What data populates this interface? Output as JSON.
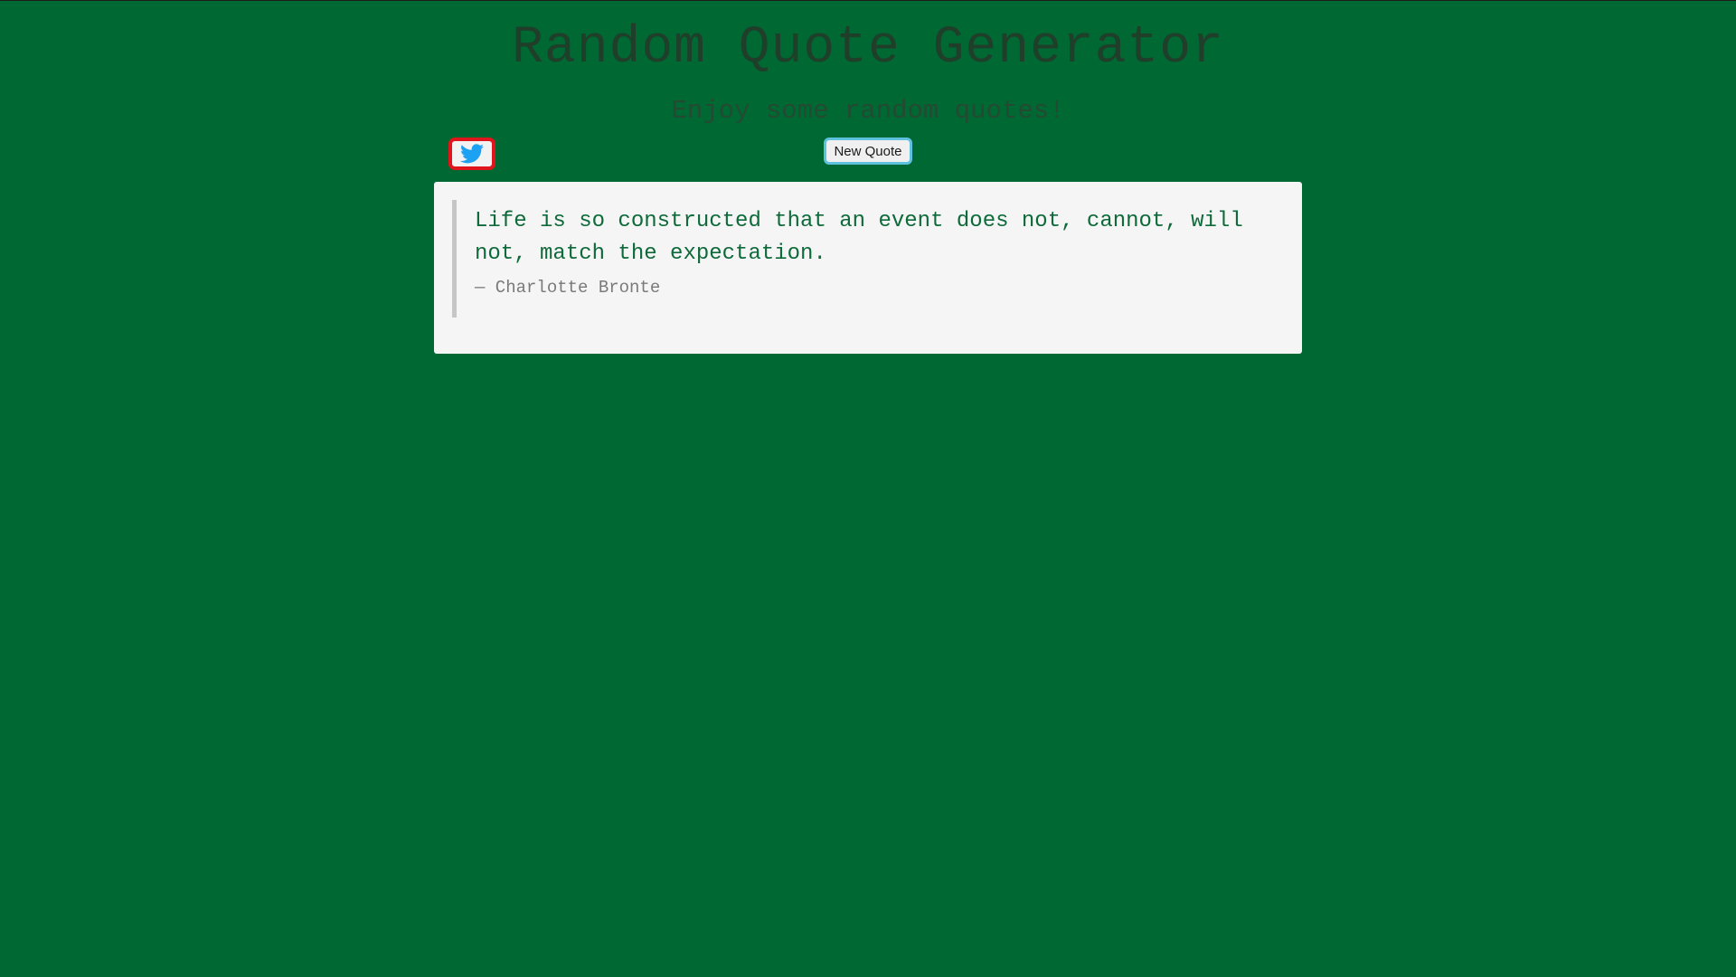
{
  "header": {
    "title": "Random Quote Generator",
    "subtitle": "Enjoy some random quotes!"
  },
  "actions": {
    "tweet_icon": "twitter-bird-icon",
    "new_quote_label": "New Quote"
  },
  "quote": {
    "text": "Life is so constructed that an event does not, cannot, will not, match the expectation.",
    "author": "— Charlotte Bronte"
  },
  "colors": {
    "background": "#006832",
    "title": "#1f3f2a",
    "quote_text": "#0e6a3a",
    "twitter_blue": "#1da1f2",
    "tweet_focus_outline": "#e0141b",
    "new_quote_focus_outline": "#5ec2de",
    "card_background": "#f5f5f5"
  }
}
